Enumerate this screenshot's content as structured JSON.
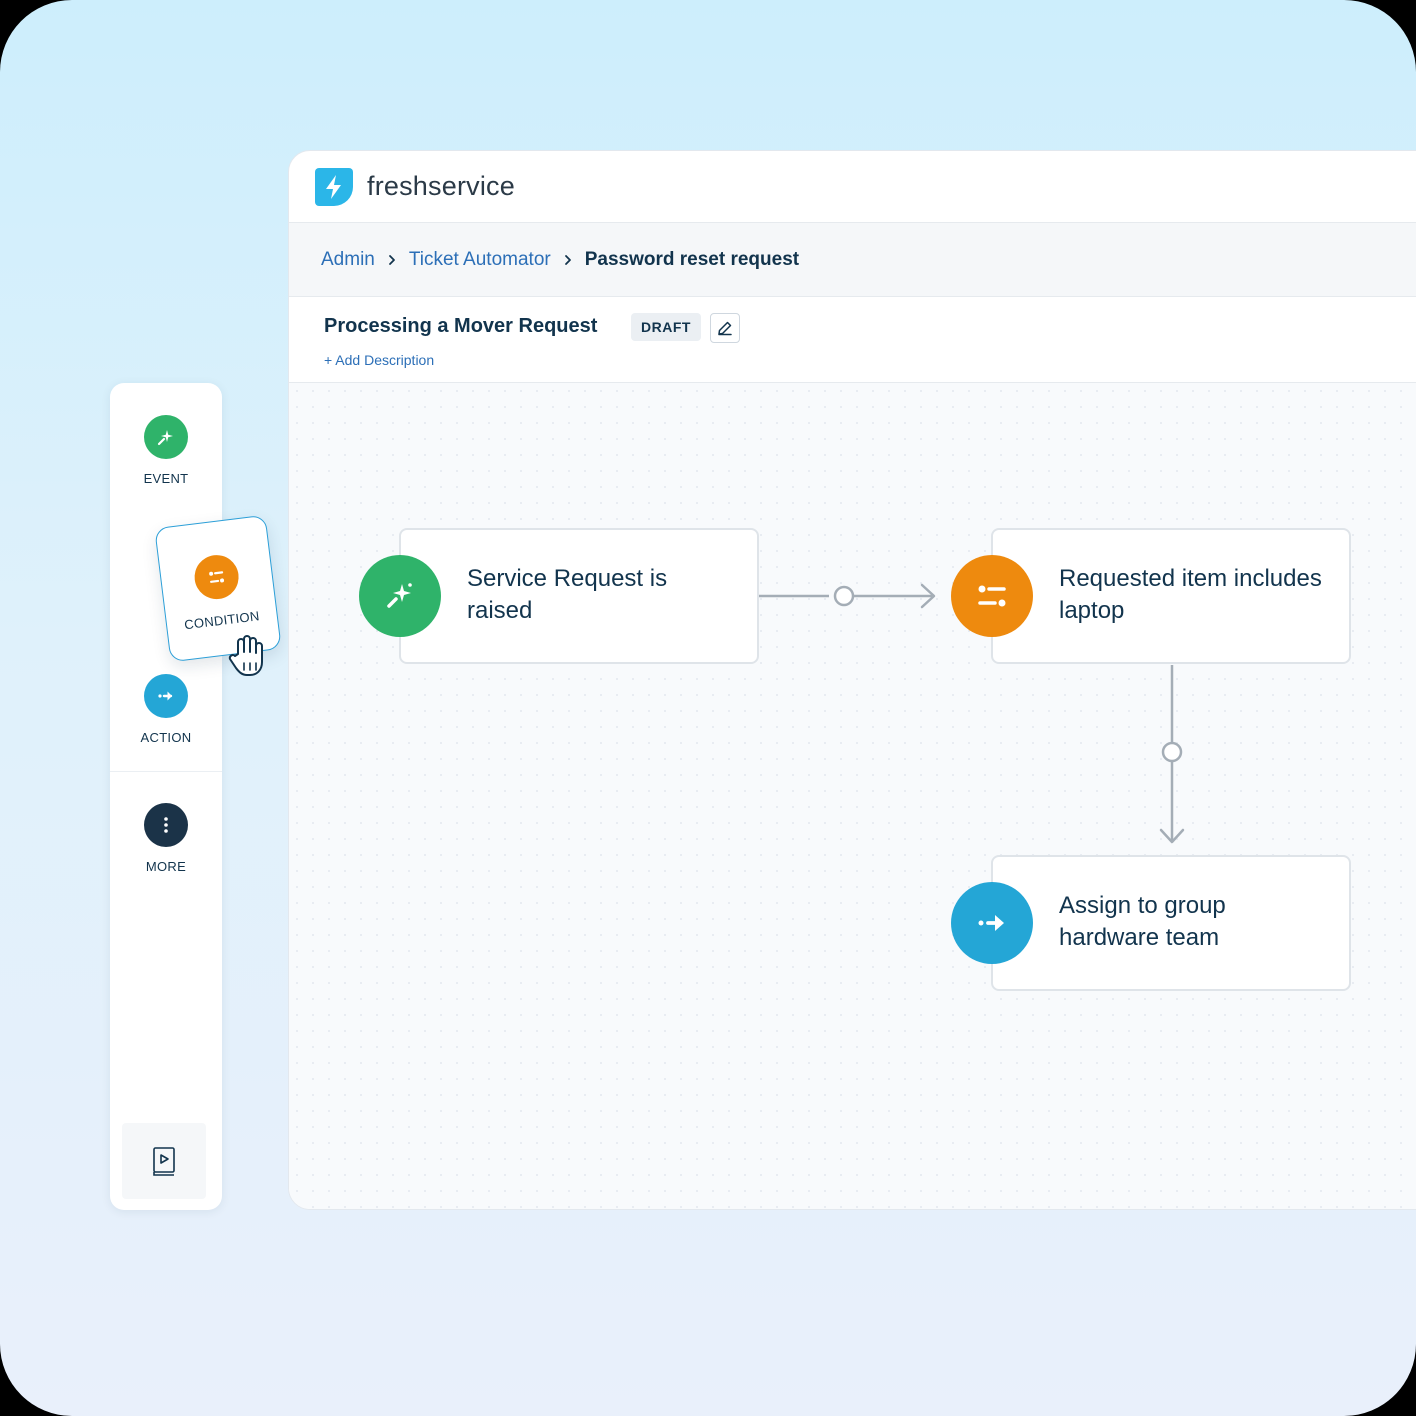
{
  "app": {
    "brand": "freshservice"
  },
  "breadcrumb": {
    "items": [
      "Admin",
      "Ticket Automator"
    ],
    "current": "Password reset request"
  },
  "workflow": {
    "title": "Processing a Mover Request",
    "status": "DRAFT",
    "add_description": "+ Add Description"
  },
  "palette": {
    "items": [
      {
        "label": "EVENT",
        "icon": "sparkle-icon",
        "color": "#2fb36a"
      },
      {
        "label": "CONDITION",
        "icon": "sliders-icon",
        "color": "#ee8a0e"
      },
      {
        "label": "ACTION",
        "icon": "arrow-right-icon",
        "color": "#24a6d6"
      },
      {
        "label": "MORE",
        "icon": "more-vertical-icon",
        "color": "#1b3348"
      }
    ],
    "bottom_icon": "playbook-icon"
  },
  "nodes": [
    {
      "type": "event",
      "text": "Service Request is raised",
      "color": "#2fb36a",
      "icon": "sparkle-icon"
    },
    {
      "type": "condition",
      "text": "Requested item includes laptop",
      "color": "#ee8a0e",
      "icon": "sliders-icon"
    },
    {
      "type": "action",
      "text": "Assign to group hardware team",
      "color": "#24a6d6",
      "icon": "arrow-right-icon"
    }
  ],
  "colors": {
    "link": "#2c6fb7",
    "text": "#12344d",
    "drag_border": "#2c9fd8"
  }
}
